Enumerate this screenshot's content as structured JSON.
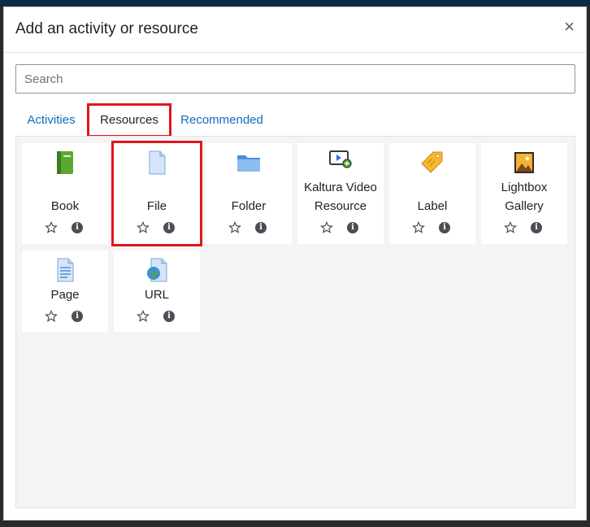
{
  "dialog": {
    "title": "Add an activity or resource",
    "close_glyph": "×"
  },
  "search": {
    "placeholder": "Search",
    "value": ""
  },
  "tabs": [
    {
      "label": "Activities",
      "selected": false
    },
    {
      "label": "Resources",
      "selected": true
    },
    {
      "label": "Recommended",
      "selected": false
    }
  ],
  "items": [
    {
      "label": "Book",
      "icon": "book-icon"
    },
    {
      "label": "File",
      "icon": "file-icon",
      "highlighted": true
    },
    {
      "label": "Folder",
      "icon": "folder-icon"
    },
    {
      "label": "Kaltura Video Resource",
      "icon": "kaltura-video-icon"
    },
    {
      "label": "Label",
      "icon": "label-tag-icon"
    },
    {
      "label": "Lightbox Gallery",
      "icon": "gallery-icon"
    },
    {
      "label": "Page",
      "icon": "page-icon"
    },
    {
      "label": "URL",
      "icon": "url-icon"
    }
  ],
  "action_icons": {
    "star": "star-outline-icon",
    "info": "info-icon",
    "info_glyph": "i"
  },
  "colors": {
    "highlight": "#e0161c",
    "link": "#0f6cbf",
    "panel_bg": "#f4f4f5"
  }
}
